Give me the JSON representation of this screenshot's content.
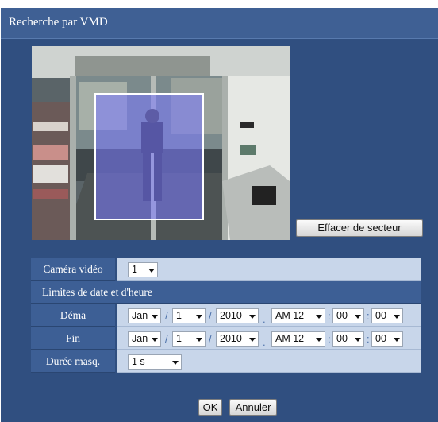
{
  "window": {
    "title": "Recherche par VMD"
  },
  "preview": {
    "selection_color": "#7a78ff"
  },
  "buttons": {
    "erase_area": "Effacer de secteur",
    "ok": "OK",
    "cancel": "Annuler"
  },
  "form": {
    "camera": {
      "label": "Caméra vidéo",
      "value": "1"
    },
    "date_section": {
      "label": "Limites de date et d'heure"
    },
    "start": {
      "label": "Déma",
      "month": "Jan",
      "day": "1",
      "year": "2010",
      "ampm_hour": "AM 12",
      "minute": "00",
      "second": "00"
    },
    "end": {
      "label": "Fin",
      "month": "Jan",
      "day": "1",
      "year": "2010",
      "ampm_hour": "AM 12",
      "minute": "00",
      "second": "00"
    },
    "duration": {
      "label": "Durée masq.",
      "value": "1 s"
    },
    "separators": {
      "date": "/",
      "time": ":",
      "dot": "."
    }
  }
}
